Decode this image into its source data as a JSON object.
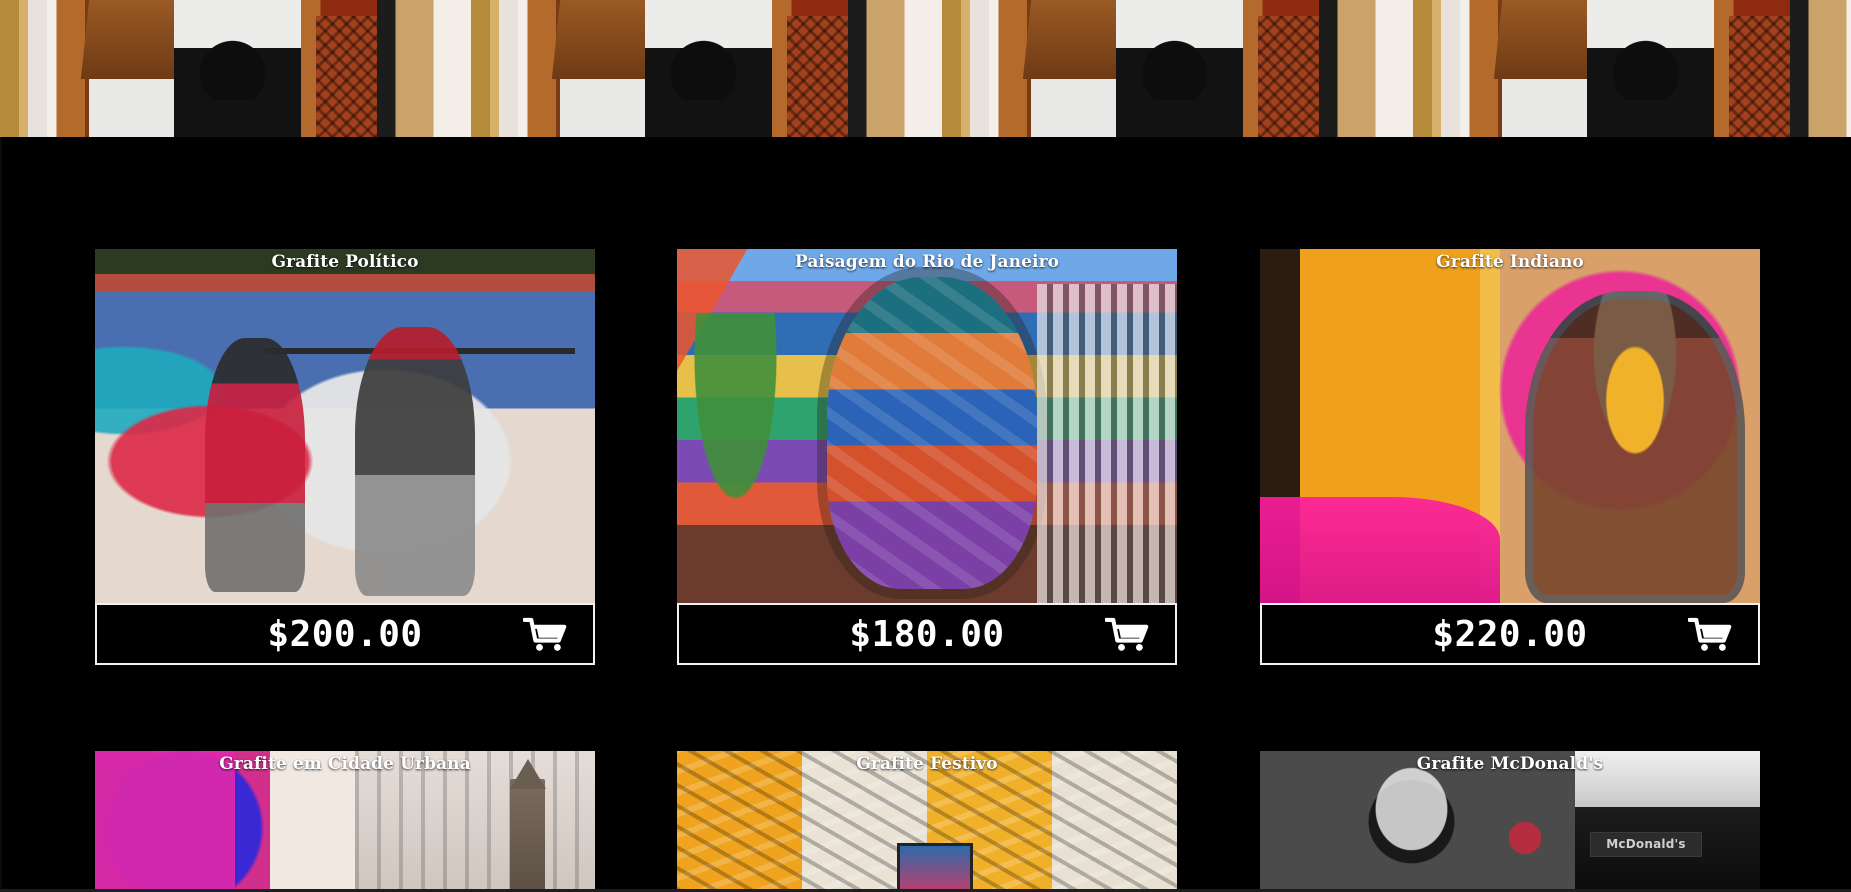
{
  "banner": {
    "icon": "wall-texture"
  },
  "products": [
    {
      "title": "Grafite Político",
      "price": "$200.00",
      "cart_icon": "shopping-cart-icon"
    },
    {
      "title": "Paisagem do Rio de Janeiro",
      "price": "$180.00",
      "cart_icon": "shopping-cart-icon"
    },
    {
      "title": "Grafite Indiano",
      "price": "$220.00",
      "cart_icon": "shopping-cart-icon"
    },
    {
      "title": "Grafite em Cidade Urbana"
    },
    {
      "title": "Grafite Festivo"
    },
    {
      "title": "Grafite McDonald's",
      "sign": "McDonald's"
    }
  ],
  "colors": {
    "background": "#000000",
    "text": "#ffffff",
    "border": "#f2f2f2"
  }
}
